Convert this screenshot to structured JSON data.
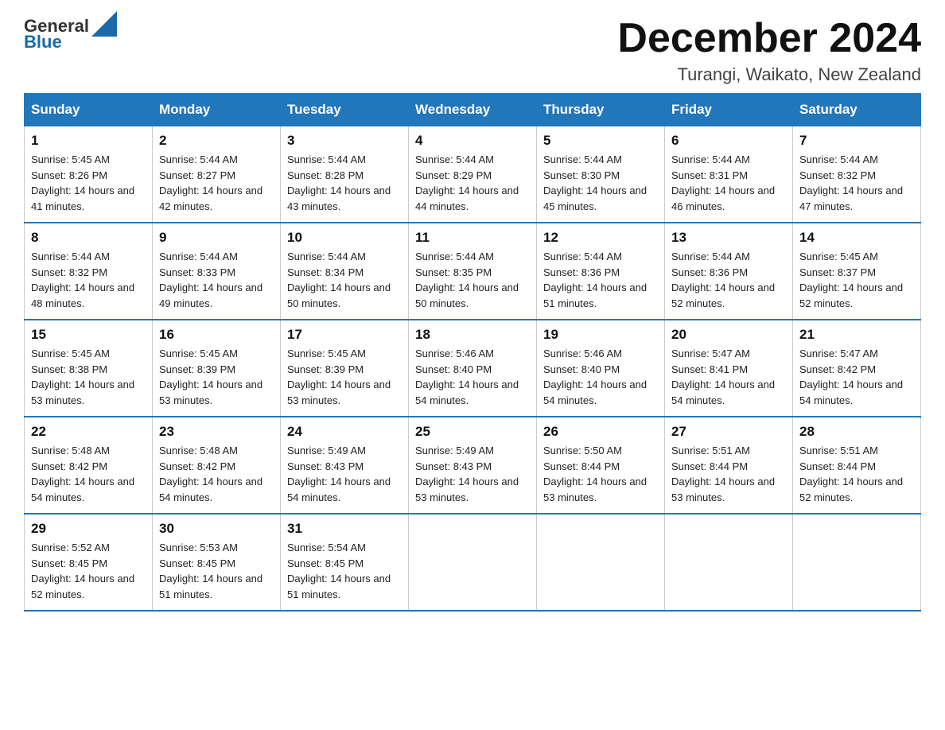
{
  "header": {
    "logo_general": "General",
    "logo_blue": "Blue",
    "month_title": "December 2024",
    "subtitle": "Turangi, Waikato, New Zealand"
  },
  "days_of_week": [
    "Sunday",
    "Monday",
    "Tuesday",
    "Wednesday",
    "Thursday",
    "Friday",
    "Saturday"
  ],
  "weeks": [
    [
      {
        "day": 1,
        "sunrise": "5:45 AM",
        "sunset": "8:26 PM",
        "daylight": "14 hours and 41 minutes."
      },
      {
        "day": 2,
        "sunrise": "5:44 AM",
        "sunset": "8:27 PM",
        "daylight": "14 hours and 42 minutes."
      },
      {
        "day": 3,
        "sunrise": "5:44 AM",
        "sunset": "8:28 PM",
        "daylight": "14 hours and 43 minutes."
      },
      {
        "day": 4,
        "sunrise": "5:44 AM",
        "sunset": "8:29 PM",
        "daylight": "14 hours and 44 minutes."
      },
      {
        "day": 5,
        "sunrise": "5:44 AM",
        "sunset": "8:30 PM",
        "daylight": "14 hours and 45 minutes."
      },
      {
        "day": 6,
        "sunrise": "5:44 AM",
        "sunset": "8:31 PM",
        "daylight": "14 hours and 46 minutes."
      },
      {
        "day": 7,
        "sunrise": "5:44 AM",
        "sunset": "8:32 PM",
        "daylight": "14 hours and 47 minutes."
      }
    ],
    [
      {
        "day": 8,
        "sunrise": "5:44 AM",
        "sunset": "8:32 PM",
        "daylight": "14 hours and 48 minutes."
      },
      {
        "day": 9,
        "sunrise": "5:44 AM",
        "sunset": "8:33 PM",
        "daylight": "14 hours and 49 minutes."
      },
      {
        "day": 10,
        "sunrise": "5:44 AM",
        "sunset": "8:34 PM",
        "daylight": "14 hours and 50 minutes."
      },
      {
        "day": 11,
        "sunrise": "5:44 AM",
        "sunset": "8:35 PM",
        "daylight": "14 hours and 50 minutes."
      },
      {
        "day": 12,
        "sunrise": "5:44 AM",
        "sunset": "8:36 PM",
        "daylight": "14 hours and 51 minutes."
      },
      {
        "day": 13,
        "sunrise": "5:44 AM",
        "sunset": "8:36 PM",
        "daylight": "14 hours and 52 minutes."
      },
      {
        "day": 14,
        "sunrise": "5:45 AM",
        "sunset": "8:37 PM",
        "daylight": "14 hours and 52 minutes."
      }
    ],
    [
      {
        "day": 15,
        "sunrise": "5:45 AM",
        "sunset": "8:38 PM",
        "daylight": "14 hours and 53 minutes."
      },
      {
        "day": 16,
        "sunrise": "5:45 AM",
        "sunset": "8:39 PM",
        "daylight": "14 hours and 53 minutes."
      },
      {
        "day": 17,
        "sunrise": "5:45 AM",
        "sunset": "8:39 PM",
        "daylight": "14 hours and 53 minutes."
      },
      {
        "day": 18,
        "sunrise": "5:46 AM",
        "sunset": "8:40 PM",
        "daylight": "14 hours and 54 minutes."
      },
      {
        "day": 19,
        "sunrise": "5:46 AM",
        "sunset": "8:40 PM",
        "daylight": "14 hours and 54 minutes."
      },
      {
        "day": 20,
        "sunrise": "5:47 AM",
        "sunset": "8:41 PM",
        "daylight": "14 hours and 54 minutes."
      },
      {
        "day": 21,
        "sunrise": "5:47 AM",
        "sunset": "8:42 PM",
        "daylight": "14 hours and 54 minutes."
      }
    ],
    [
      {
        "day": 22,
        "sunrise": "5:48 AM",
        "sunset": "8:42 PM",
        "daylight": "14 hours and 54 minutes."
      },
      {
        "day": 23,
        "sunrise": "5:48 AM",
        "sunset": "8:42 PM",
        "daylight": "14 hours and 54 minutes."
      },
      {
        "day": 24,
        "sunrise": "5:49 AM",
        "sunset": "8:43 PM",
        "daylight": "14 hours and 54 minutes."
      },
      {
        "day": 25,
        "sunrise": "5:49 AM",
        "sunset": "8:43 PM",
        "daylight": "14 hours and 53 minutes."
      },
      {
        "day": 26,
        "sunrise": "5:50 AM",
        "sunset": "8:44 PM",
        "daylight": "14 hours and 53 minutes."
      },
      {
        "day": 27,
        "sunrise": "5:51 AM",
        "sunset": "8:44 PM",
        "daylight": "14 hours and 53 minutes."
      },
      {
        "day": 28,
        "sunrise": "5:51 AM",
        "sunset": "8:44 PM",
        "daylight": "14 hours and 52 minutes."
      }
    ],
    [
      {
        "day": 29,
        "sunrise": "5:52 AM",
        "sunset": "8:45 PM",
        "daylight": "14 hours and 52 minutes."
      },
      {
        "day": 30,
        "sunrise": "5:53 AM",
        "sunset": "8:45 PM",
        "daylight": "14 hours and 51 minutes."
      },
      {
        "day": 31,
        "sunrise": "5:54 AM",
        "sunset": "8:45 PM",
        "daylight": "14 hours and 51 minutes."
      },
      null,
      null,
      null,
      null
    ]
  ]
}
